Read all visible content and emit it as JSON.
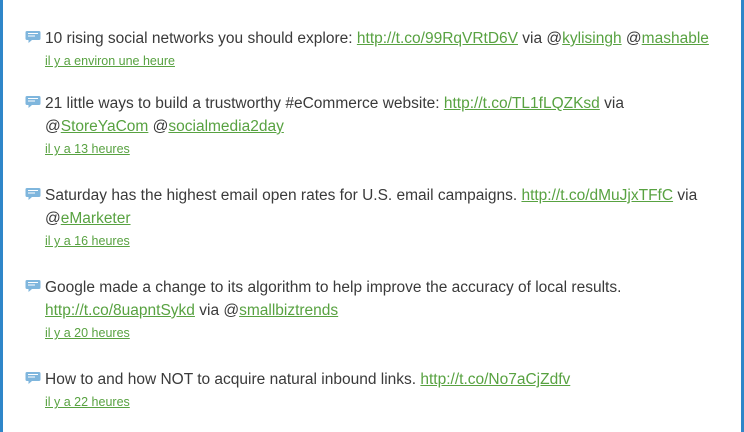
{
  "tweets": [
    {
      "line1": [
        {
          "t": "text",
          "v": "10 rising social networks you should explore: "
        },
        {
          "t": "link",
          "v": "http://t.co/99RqVRtD6V"
        },
        {
          "t": "text",
          "v": " via @"
        },
        {
          "t": "link",
          "v": "kylisingh"
        },
        {
          "t": "text",
          "v": " @"
        },
        {
          "t": "link",
          "v": "mashable"
        }
      ],
      "line2": [],
      "time": "il y a environ une heure"
    },
    {
      "line1": [
        {
          "t": "text",
          "v": "21 little ways to build a trustworthy #eCommerce website: "
        },
        {
          "t": "link",
          "v": "http://t.co/TL1fLQZKsd"
        },
        {
          "t": "text",
          "v": " via"
        }
      ],
      "line2": [
        {
          "t": "text",
          "v": "@"
        },
        {
          "t": "link",
          "v": "StoreYaCom"
        },
        {
          "t": "text",
          "v": " @"
        },
        {
          "t": "link",
          "v": "socialmedia2day"
        }
      ],
      "time": "il y a 13 heures"
    },
    {
      "line1": [
        {
          "t": "text",
          "v": "Saturday has the highest email open rates for U.S. email campaigns. "
        },
        {
          "t": "link",
          "v": "http://t.co/dMuJjxTFfC"
        },
        {
          "t": "text",
          "v": " via"
        }
      ],
      "line2": [
        {
          "t": "text",
          "v": "@"
        },
        {
          "t": "link",
          "v": "eMarketer"
        }
      ],
      "time": "il y a 16 heures"
    },
    {
      "line1": [
        {
          "t": "text",
          "v": "Google made a change to its algorithm to help improve the accuracy of local results."
        }
      ],
      "line2": [
        {
          "t": "link",
          "v": "http://t.co/8uapntSykd"
        },
        {
          "t": "text",
          "v": " via @"
        },
        {
          "t": "link",
          "v": "smallbiztrends"
        }
      ],
      "time": "il y a 20 heures"
    },
    {
      "line1": [
        {
          "t": "text",
          "v": "How to and how NOT to acquire natural inbound links. "
        },
        {
          "t": "link",
          "v": "http://t.co/No7aCjZdfv"
        }
      ],
      "line2": [],
      "time": "il y a 22 heures"
    }
  ],
  "colors": {
    "border": "#2f86c9",
    "link": "#58a241",
    "text": "#3a3a3a",
    "bubble": "#7fb6dd"
  },
  "icon": "speech-bubble-icon"
}
